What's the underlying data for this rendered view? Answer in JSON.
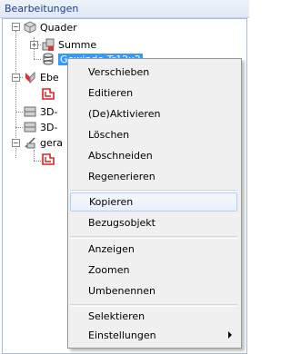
{
  "panel": {
    "title": "Bearbeitungen"
  },
  "tree": {
    "quader": "Quader",
    "summe": "Summe",
    "gewinde": "Gewinde Tr12x2",
    "ebene": "Ebe",
    "item_3d_1": "3D-",
    "item_3d_2": "3D-",
    "gerade": "gera"
  },
  "menu": {
    "items": [
      "Verschieben",
      "Editieren",
      "(De)Aktivieren",
      "Löschen",
      "Abschneiden",
      "Regenerieren",
      "Kopieren",
      "Bezugsobjekt",
      "Anzeigen",
      "Zoomen",
      "Umbenennen",
      "Selektieren",
      "Einstellungen"
    ]
  }
}
